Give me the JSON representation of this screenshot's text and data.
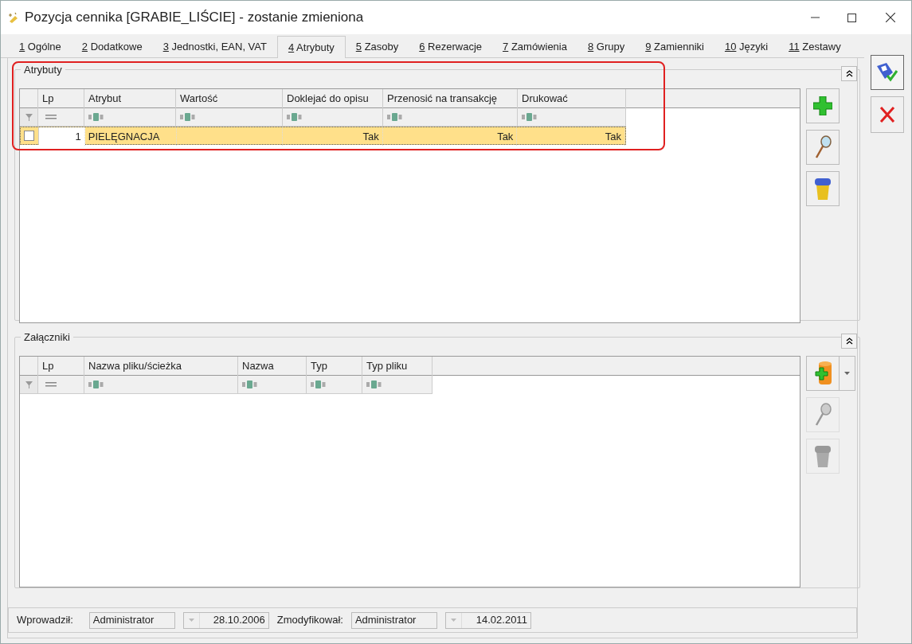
{
  "window": {
    "title": "Pozycja cennika [GRABIE_LIŚCIE] - zostanie zmieniona"
  },
  "tabs": [
    {
      "number": "1",
      "label": "Ogólne",
      "selected": false
    },
    {
      "number": "2",
      "label": "Dodatkowe",
      "selected": false
    },
    {
      "number": "3",
      "label": "Jednostki, EAN, VAT",
      "selected": false
    },
    {
      "number": "4",
      "label": "Atrybuty",
      "selected": true
    },
    {
      "number": "5",
      "label": "Zasoby",
      "selected": false
    },
    {
      "number": "6",
      "label": "Rezerwacje",
      "selected": false
    },
    {
      "number": "7",
      "label": "Zamówienia",
      "selected": false
    },
    {
      "number": "8",
      "label": "Grupy",
      "selected": false
    },
    {
      "number": "9",
      "label": "Zamienniki",
      "selected": false
    },
    {
      "number": "10",
      "label": "Języki",
      "selected": false
    },
    {
      "number": "11",
      "label": "Zestawy",
      "selected": false
    }
  ],
  "attributes": {
    "title": "Atrybuty",
    "highlighted": true,
    "columns": [
      {
        "label": "Lp",
        "kind": "number"
      },
      {
        "label": "Atrybut",
        "kind": "text"
      },
      {
        "label": "Wartość",
        "kind": "text"
      },
      {
        "label": "Doklejać do opisu",
        "kind": "text"
      },
      {
        "label": "Przenosić na transakcję",
        "kind": "text"
      },
      {
        "label": "Drukować",
        "kind": "text"
      }
    ],
    "rows": [
      {
        "checked": false,
        "selected": true,
        "lp": "1",
        "attribute": "PIELĘGNACJA",
        "append": "Tak",
        "transfer": "Tak",
        "print": "Tak"
      }
    ],
    "actions": [
      {
        "kind": "add",
        "disabled": false
      },
      {
        "kind": "view",
        "disabled": false
      },
      {
        "kind": "delete",
        "disabled": false
      }
    ]
  },
  "attachments": {
    "title": "Załączniki",
    "columns": [
      {
        "label": "Lp",
        "kind": "number"
      },
      {
        "label": "Nazwa pliku/ścieżka",
        "kind": "text"
      },
      {
        "label": "Nazwa",
        "kind": "text"
      },
      {
        "label": "Typ",
        "kind": "text"
      },
      {
        "label": "Typ pliku",
        "kind": "text"
      }
    ],
    "actions": [
      {
        "kind": "add-file",
        "disabled": false,
        "dropdown": true
      },
      {
        "kind": "view",
        "disabled": true
      },
      {
        "kind": "delete",
        "disabled": true
      }
    ]
  },
  "footer": {
    "created_label": "Wprowadził:",
    "created_by": "Administrator",
    "created_date": "28.10.2006",
    "modified_label": "Zmodyfikował:",
    "modified_by": "Administrator",
    "modified_date": "14.02.2011"
  }
}
